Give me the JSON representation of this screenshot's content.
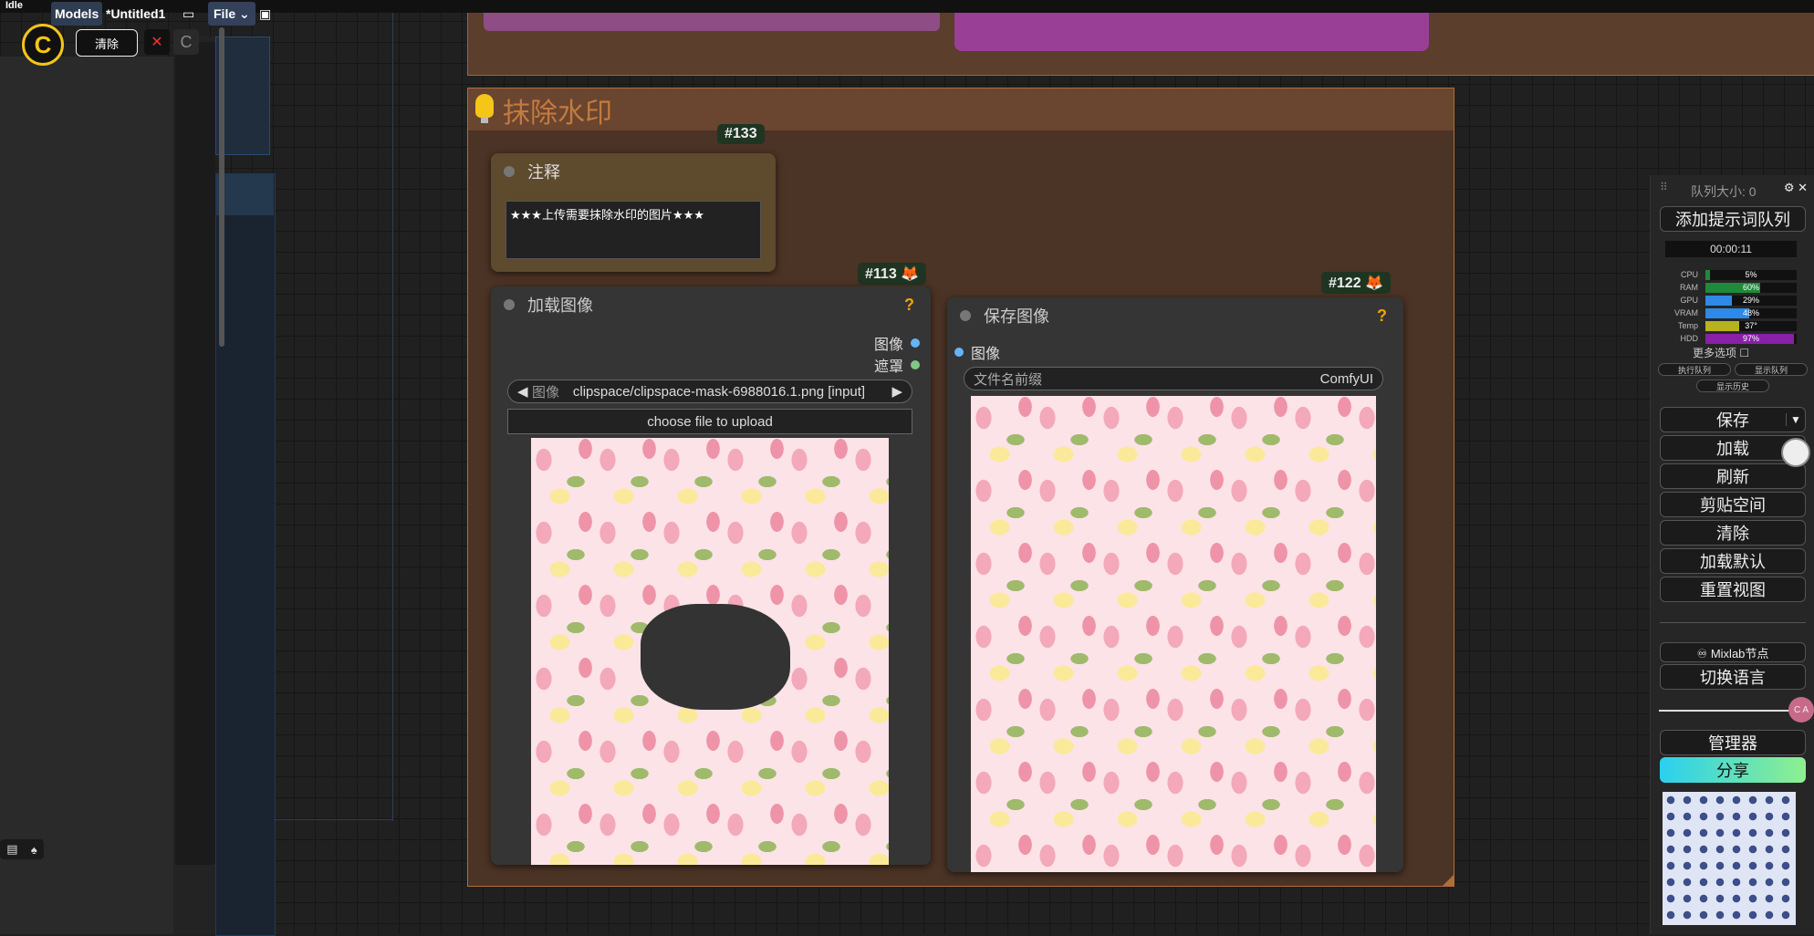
{
  "status": "Idle",
  "topbar": {
    "models_label": "Models",
    "workflow_title": "*Untitled1",
    "file_menu": "File",
    "clear_label": "清除",
    "close_glyph": "✕",
    "c_glyph": "C"
  },
  "group": {
    "title": "抹除水印"
  },
  "note_node": {
    "id": "#133",
    "title": "注释",
    "text": "★★★上传需要抹除水印的图片★★★"
  },
  "load_node": {
    "id": "#113 🦊",
    "title": "加载图像",
    "help": "?",
    "outputs": [
      "图像",
      "遮罩"
    ],
    "image_widget_label": "图像",
    "image_value": "clipspace/clipspace-mask-6988016.1.png [input]",
    "upload_label": "choose file to upload"
  },
  "save_node": {
    "id": "#122 🦊",
    "title": "保存图像",
    "help": "?",
    "input": "图像",
    "prefix_label": "文件名前缀",
    "prefix_value": "ComfyUI"
  },
  "panel": {
    "queue_size": "队列大小: 0",
    "queue_prompt": "添加提示词队列",
    "timer": "00:00:11",
    "stats": [
      {
        "label": "CPU",
        "value": "5%",
        "pct": 5,
        "color": "#1f8a3a"
      },
      {
        "label": "RAM",
        "value": "60%",
        "pct": 60,
        "color": "#1f8a3a"
      },
      {
        "label": "GPU",
        "value": "29%",
        "pct": 29,
        "color": "#2e8ae6"
      },
      {
        "label": "VRAM",
        "value": "48%",
        "pct": 48,
        "color": "#2e8ae6"
      },
      {
        "label": "Temp",
        "value": "37°",
        "pct": 37,
        "color": "#b7b31f"
      },
      {
        "label": "HDD",
        "value": "97%",
        "pct": 97,
        "color": "#8a1fa8"
      }
    ],
    "more_options": "更多选项",
    "view_queue": "执行队列",
    "view_queue2": "显示队列",
    "view_history": "显示历史",
    "save": "保存",
    "load": "加载",
    "refresh": "刷新",
    "clipspace": "剪贴空间",
    "clear": "清除",
    "load_default": "加载默认",
    "reset_view": "重置视图",
    "mixlab": "♾ Mixlab节点",
    "switch_lang": "切换语言",
    "manager": "管理器",
    "share": "分享",
    "slider_label": "C A"
  }
}
